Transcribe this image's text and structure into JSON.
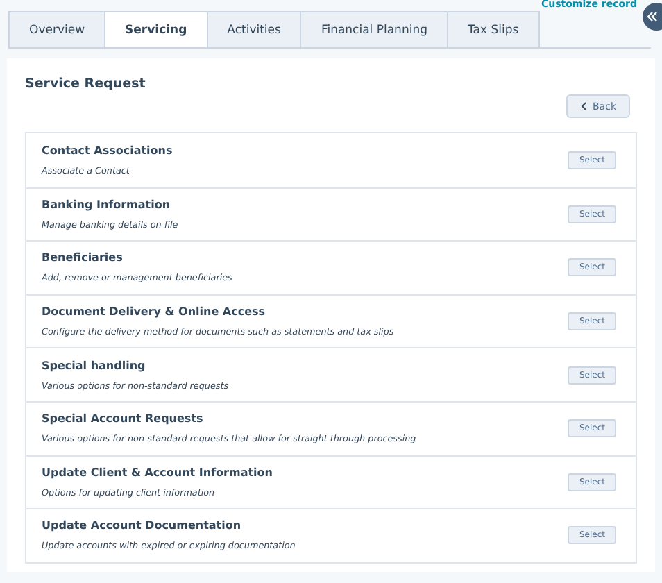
{
  "header": {
    "link": "Customize record"
  },
  "tabs": [
    {
      "label": "Overview",
      "selected": false
    },
    {
      "label": "Servicing",
      "selected": true
    },
    {
      "label": "Activities",
      "selected": false
    },
    {
      "label": "Financial Planning",
      "selected": false
    },
    {
      "label": "Tax Slips",
      "selected": false
    }
  ],
  "panel": {
    "title": "Service Request",
    "back": "Back",
    "items": [
      {
        "title": "Contact Associations",
        "description": "Associate a Contact",
        "button": "Select"
      },
      {
        "title": "Banking Information",
        "description": "Manage banking details on file",
        "button": "Select"
      },
      {
        "title": "Beneficiaries",
        "description": "Add, remove or management beneficiaries",
        "button": "Select"
      },
      {
        "title": "Document Delivery & Online Access",
        "description": "Configure the delivery method for documents such as statements and tax slips",
        "button": "Select"
      },
      {
        "title": "Special handling",
        "description": "Various options for non-standard requests",
        "button": "Select"
      },
      {
        "title": "Special Account Requests",
        "description": "Various options for non-standard requests that allow for straight through processing",
        "button": "Select"
      },
      {
        "title": "Update Client & Account Information",
        "description": "Options for updating client information",
        "button": "Select"
      },
      {
        "title": "Update Account Documentation",
        "description": "Update accounts with expired or expiring documentation",
        "button": "Select"
      }
    ]
  }
}
